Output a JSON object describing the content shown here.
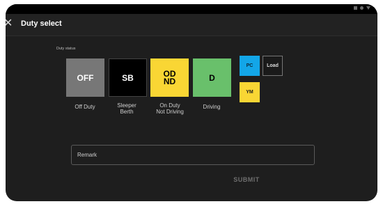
{
  "appbar": {
    "title": "Duty select",
    "back_icon": "close-icon"
  },
  "duty_status": {
    "label": "Duty status",
    "tiles": [
      {
        "code": "OFF",
        "caption": "Off Duty",
        "color": "#777777"
      },
      {
        "code": "SB",
        "caption": "Sleeper\nBerth",
        "color": "#000000"
      },
      {
        "code": "OD\nND",
        "caption": "On Duty\nNot Driving",
        "color": "#f9d634"
      },
      {
        "code": "D",
        "caption": "Driving",
        "color": "#69c06b"
      }
    ]
  },
  "special": {
    "pc": {
      "label": "PC",
      "color": "#13a6e8"
    },
    "load": {
      "label": "Load"
    },
    "ym": {
      "label": "YM",
      "color": "#f9d634"
    }
  },
  "remark": {
    "placeholder": "Remark",
    "value": ""
  },
  "submit": {
    "label": "SUBMIT"
  }
}
